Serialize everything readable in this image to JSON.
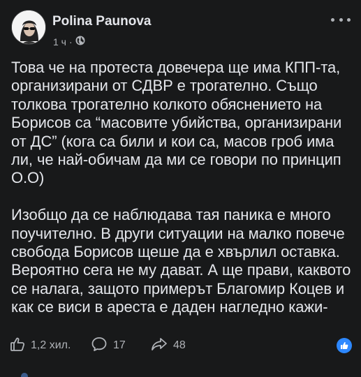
{
  "post": {
    "author": "Polina Paunova",
    "time": "1 ч",
    "separator": "·",
    "paragraphs": [
      "Това че на протеста довечера ще има КПП-та, организирани от СДВР е трогателно. Също толкова трогателно колкото обяснението на Борисов са “масовите убийства, организирани от ДС” (кога са били и кои са, масов гроб има ли, че най-обичам да ми се говори по принцип О.О)",
      "Изобщо да се наблюдава тая паника е много поучително. В други ситуации на малко повече свобода Борисов щеше да е хвърлил оставка. Вероятно сега не му дават. А ще прави, каквото се налага, защото примерът Благомир Коцев и как се виси в ареста е даден нагледно кажи-речи за него."
    ]
  },
  "actions": {
    "likes": "1,2 хил.",
    "comments": "17",
    "shares": "48"
  },
  "icons": {
    "more": "more-options-icon",
    "audience": "globe-icon",
    "like": "thumbs-up-icon",
    "comment": "comment-icon",
    "share": "share-icon",
    "reaction": "like-reaction-icon"
  },
  "colors": {
    "background": "#18191a",
    "text": "#e4e6eb",
    "secondary": "#b0b3b8",
    "accent": "#2d88ff"
  }
}
